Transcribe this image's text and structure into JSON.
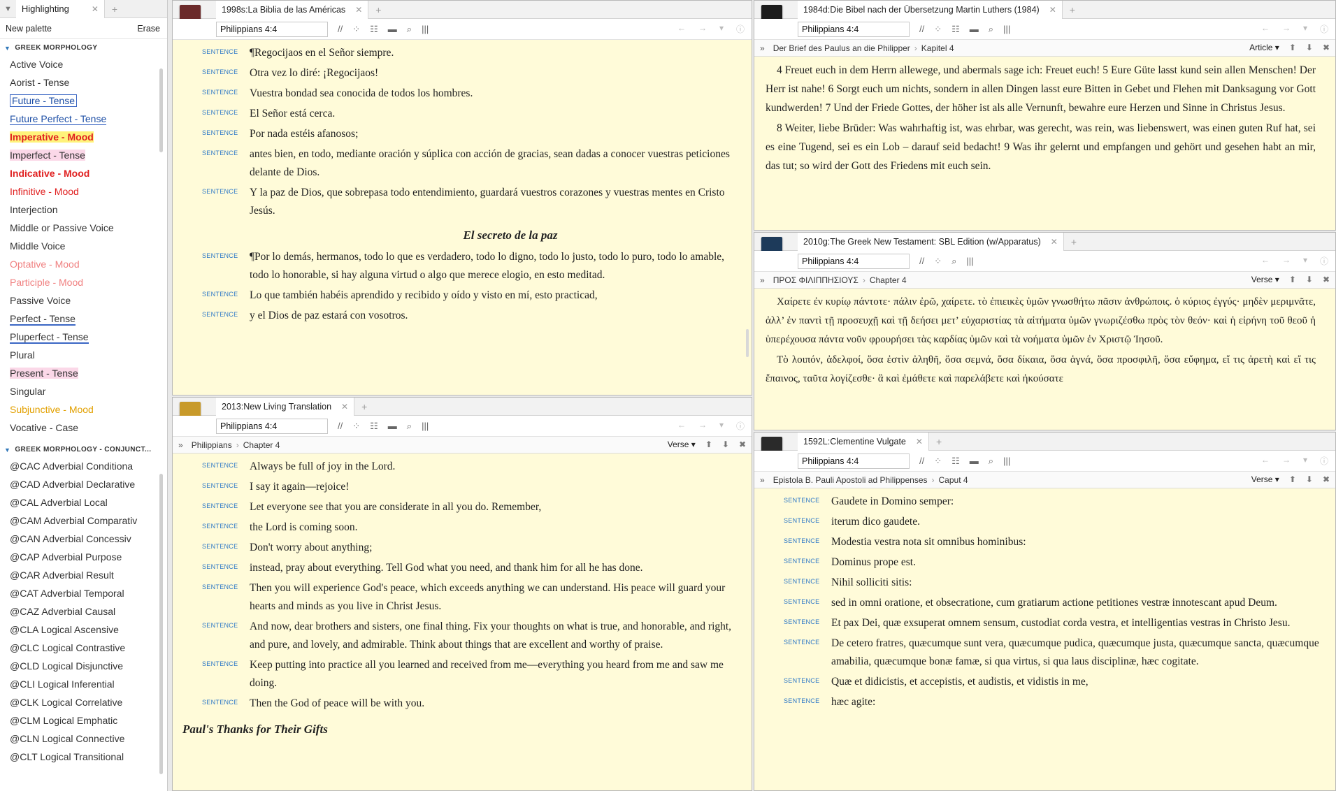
{
  "sidebar": {
    "tab_label": "Highlighting",
    "palette_label": "New palette",
    "erase_label": "Erase",
    "section1": "GREEK MORPHOLOGY",
    "items1": [
      {
        "label": "Active Voice",
        "color": "#333333",
        "weight": "normal",
        "style": "plain"
      },
      {
        "label": "Aorist - Tense",
        "color": "#333333",
        "weight": "normal",
        "style": "plain"
      },
      {
        "label": "Future - Tense",
        "color": "#1e4fa6",
        "weight": "normal",
        "style": "box"
      },
      {
        "label": "Future Perfect - Tense",
        "color": "#1e4fa6",
        "weight": "normal",
        "style": "underline"
      },
      {
        "label": "Imperative - Mood",
        "color": "#e02020",
        "weight": "bold",
        "style": "yellow"
      },
      {
        "label": "Imperfect - Tense",
        "color": "#333333",
        "weight": "normal",
        "style": "pink"
      },
      {
        "label": "Indicative - Mood",
        "color": "#e02020",
        "weight": "bold",
        "style": "plain"
      },
      {
        "label": "Infinitive - Mood",
        "color": "#e02020",
        "weight": "normal",
        "style": "plain"
      },
      {
        "label": "Interjection",
        "color": "#333333",
        "weight": "normal",
        "style": "plain"
      },
      {
        "label": "Middle or Passive Voice",
        "color": "#333333",
        "weight": "normal",
        "style": "plain"
      },
      {
        "label": "Middle Voice",
        "color": "#333333",
        "weight": "normal",
        "style": "plain"
      },
      {
        "label": "Optative - Mood",
        "color": "#f08080",
        "weight": "normal",
        "style": "plain"
      },
      {
        "label": "Participle - Mood",
        "color": "#f08080",
        "weight": "normal",
        "style": "plain"
      },
      {
        "label": "Passive Voice",
        "color": "#333333",
        "weight": "normal",
        "style": "plain"
      },
      {
        "label": "Perfect - Tense",
        "color": "#333333",
        "weight": "normal",
        "style": "blueline"
      },
      {
        "label": "Pluperfect - Tense",
        "color": "#333333",
        "weight": "normal",
        "style": "blueline"
      },
      {
        "label": "Plural",
        "color": "#333333",
        "weight": "normal",
        "style": "plain"
      },
      {
        "label": "Present - Tense",
        "color": "#333333",
        "weight": "normal",
        "style": "pink"
      },
      {
        "label": "Singular",
        "color": "#333333",
        "weight": "normal",
        "style": "plain"
      },
      {
        "label": "Subjunctive - Mood",
        "color": "#e2a000",
        "weight": "normal",
        "style": "plain"
      },
      {
        "label": "Vocative - Case",
        "color": "#333333",
        "weight": "normal",
        "style": "plain"
      }
    ],
    "section2": "GREEK MORPHOLOGY - CONJUNCT...",
    "items2": [
      "@CAC Adverbial Conditiona",
      "@CAD Adverbial Declarative",
      "@CAL Adverbial Local",
      "@CAM Adverbial Comparativ",
      "@CAN Adverbial Concessiv",
      "@CAP Adverbial Purpose",
      "@CAR Adverbial Result",
      "@CAT Adverbial Temporal",
      "@CAZ Adverbial Causal",
      "@CLA Logical Ascensive",
      "@CLC Logical Contrastive",
      "@CLD Logical Disjunctive",
      "@CLI Logical Inferential",
      "@CLK Logical Correlative",
      "@CLM Logical Emphatic",
      "@CLN Logical Connective",
      "@CLT Logical Transitional"
    ]
  },
  "ref": "Philippians 4:4",
  "label": "SENTENCE",
  "panels": {
    "lbla": {
      "title": "1998s:La Biblia de las Américas",
      "cover_color": "#6b2a2a",
      "heading": "El secreto de la paz",
      "rows": [
        "¶Regocijaos en el Señor siempre.",
        "Otra vez lo diré: ¡Regocijaos!",
        "Vuestra bondad sea conocida de todos los hombres.",
        "El Señor está cerca.",
        "Por nada estéis afanosos;",
        "antes bien, en todo, mediante oración y súplica con acción de gracias, sean dadas a conocer vuestras peticiones delante de Dios.",
        "Y la paz de Dios, que sobrepasa todo entendimiento, guardará vuestros corazones y vuestras mentes en Cristo Jesús.",
        "¶Por lo demás, hermanos, todo lo que es verdadero, todo lo digno, todo lo justo, todo lo puro, todo lo amable, todo lo honorable, si hay alguna virtud o algo que merece elogio, en esto meditad.",
        "Lo que también habéis aprendido y recibido y oído y visto en mí, esto practicad,",
        "y el Dios de paz estará con vosotros."
      ]
    },
    "nlt": {
      "title": "2013:New Living Translation",
      "cover_color": "#c89a2a",
      "crumb1": "Philippians",
      "crumb2": "Chapter 4",
      "mode": "Verse",
      "rows": [
        "Always be full of joy in the Lord.",
        "I say it again—rejoice!",
        "Let everyone see that you are considerate in all you do. Remember,",
        "the Lord is coming soon.",
        "Don't worry about anything;",
        "instead, pray about everything. Tell God what you need, and thank him for all he has done.",
        "Then you will experience God's peace, which exceeds anything we can understand. His peace will guard your hearts and minds as you live in Christ Jesus.",
        "And now, dear brothers and sisters, one final thing. Fix your thoughts on what is true, and honorable, and right, and pure, and lovely, and admirable. Think about things that are excellent and worthy of praise.",
        "Keep putting into practice all you learned and received from me—everything you heard from me and saw me doing.",
        "Then the God of peace will be with you."
      ],
      "next_heading": "Paul's Thanks for Their Gifts"
    },
    "luther": {
      "title": "1984d:Die Bibel nach der Übersetzung Martin Luthers (1984)",
      "cover_color": "#1c1c1c",
      "crumb1": "Der Brief des Paulus an die Philipper",
      "crumb2": "Kapitel 4",
      "mode": "Article",
      "paragraphs": [
        "4 Freuet euch in dem Herrn allewege, und abermals sage ich: Freuet euch! 5 Eure Güte lasst kund sein allen Menschen! Der Herr ist nahe! 6 Sorgt euch um nichts, sondern in allen Dingen lasst eure Bitten in Gebet und Flehen mit Danksagung vor Gott kundwerden! 7 Und der Friede Gottes, der höher ist als alle Vernunft, bewahre eure Herzen und Sinne in Christus Jesus.",
        "8 Weiter, liebe Brüder: Was wahrhaftig ist, was ehrbar, was gerecht, was rein, was liebenswert, was einen guten Ruf hat, sei es eine Tugend, sei es ein Lob – darauf seid bedacht! 9 Was ihr gelernt und empfangen und gehört und gesehen habt an mir, das tut; so wird der Gott des Friedens mit euch sein."
      ]
    },
    "sbl": {
      "title": "2010g:The Greek New Testament: SBL Edition (w/Apparatus)",
      "cover_color": "#1d3a5a",
      "crumb1": "ΠΡΟΣ ΦΙΛΙΠΠΗΣΙΟΥΣ",
      "crumb2": "Chapter 4",
      "mode": "Verse",
      "paragraphs": [
        "Χαίρετε ἐν κυρίῳ πάντοτε· πάλιν ἐρῶ, χαίρετε. τὸ ἐπιεικὲς ὑμῶν γνωσθήτω πᾶσιν ἀνθρώποις. ὁ κύριος ἐγγύς· μηδὲν μεριμνᾶτε, ἀλλ’ ἐν παντὶ τῇ προσευχῇ καὶ τῇ δεήσει μετ’ εὐχαριστίας τὰ αἰτήματα ὑμῶν γνωριζέσθω πρὸς τὸν θεόν· καὶ ἡ εἰρήνη τοῦ θεοῦ ἡ ὑπερέχουσα πάντα νοῦν φρουρήσει τὰς καρδίας ὑμῶν καὶ τὰ νοήματα ὑμῶν ἐν Χριστῷ Ἰησοῦ.",
        "Τὸ λοιπόν, ἀδελφοί, ὅσα ἐστὶν ἀληθῆ, ὅσα σεμνά, ὅσα δίκαια, ὅσα ἁγνά, ὅσα προσφιλῆ, ὅσα εὔφημα, εἴ τις ἀρετὴ καὶ εἴ τις ἔπαινος, ταῦτα λογίζεσθε· ἃ καὶ ἐμάθετε καὶ παρελάβετε καὶ ἠκούσατε"
      ]
    },
    "vulgate": {
      "title": "1592L:Clementine Vulgate",
      "cover_color": "#2a2a2a",
      "crumb1": "Epistola B. Pauli Apostoli ad Philippenses",
      "crumb2": "Caput 4",
      "mode": "Verse",
      "rows": [
        "Gaudete in Domino semper:",
        "iterum dico gaudete.",
        "Modestia vestra nota sit omnibus hominibus:",
        "Dominus prope est.",
        "Nihil solliciti sitis:",
        "sed in omni oratione, et obsecratione, cum gratiarum actione petitiones vestræ innotescant apud Deum.",
        "Et pax Dei, quæ exsuperat omnem sensum, custodiat corda vestra, et intelligentias vestras in Christo Jesu.",
        "De cetero fratres, quæcumque sunt vera, quæcumque pudica, quæcumque justa, quæcumque sancta, quæcumque amabilia, quæcumque bonæ famæ, si qua virtus, si qua laus disciplinæ, hæc cogitate.",
        "Quæ et didicistis, et accepistis, et audistis, et vidistis in me,",
        "hæc agite:"
      ]
    }
  }
}
